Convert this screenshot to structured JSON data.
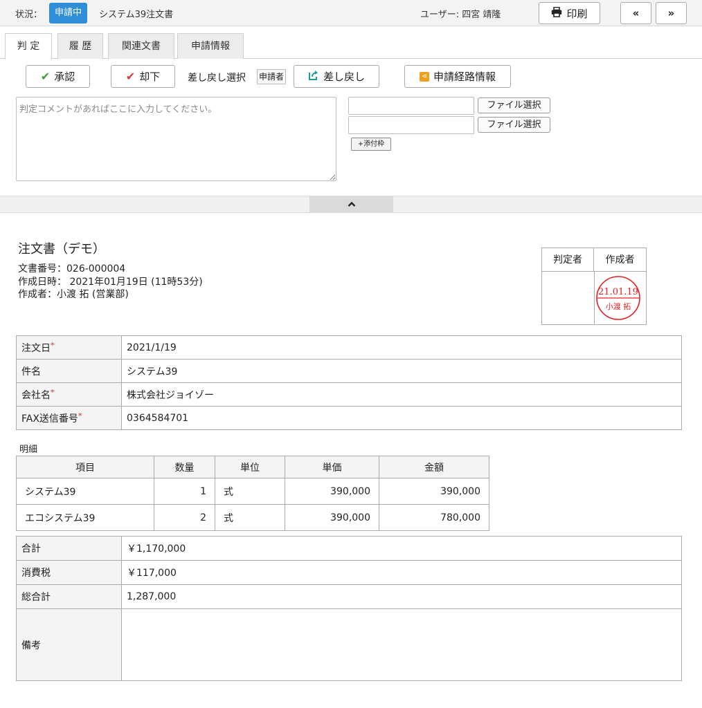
{
  "topbar": {
    "status_label": "状況：",
    "status_badge": "申請中",
    "doc_title": "システム39注文書",
    "user": "ユーザー: 四宮 靖隆",
    "print_label": "印刷",
    "prev_label": "«",
    "next_label": "»"
  },
  "tabs": [
    {
      "label": "判 定"
    },
    {
      "label": "履 歴"
    },
    {
      "label": "関連文書"
    },
    {
      "label": "申請情報"
    }
  ],
  "actions": {
    "approve": "承認",
    "reject": "却下",
    "sendback_select_label": "差し戻し選択",
    "sendback_target": "申請者",
    "sendback": "差し戻し",
    "route_info": "申請経路情報"
  },
  "comment": {
    "placeholder": "判定コメントがあればここに入力してください。"
  },
  "files": {
    "select_label": "ファイル選択",
    "add_attachment": "+添付枠"
  },
  "collapse_icon": "^",
  "document": {
    "heading": "注文書（デモ）",
    "doc_number": "文書番号：026-000004",
    "created_at": "作成日時： 2021年01月19日 (11時53分)",
    "author": "作成者：小渡 拓 (営業部)"
  },
  "stamp": {
    "judge_header": "判定者",
    "creator_header": "作成者",
    "seal_date": "21.01.19",
    "seal_name": "小渡 拓",
    "seal_color": "#e02020"
  },
  "info": [
    {
      "label": "注文日",
      "required": "*",
      "value": "2021/1/19"
    },
    {
      "label": "件名",
      "required": "",
      "value": "システム39"
    },
    {
      "label": "会社名",
      "required": "*",
      "value": "株式会社ジョイゾー"
    },
    {
      "label": "FAX送信番号",
      "required": "*",
      "value": "0364584701"
    }
  ],
  "detail": {
    "label": "明細",
    "headers": [
      "項目",
      "数量",
      "単位",
      "単価",
      "金額"
    ],
    "rows": [
      [
        "システム39",
        "1",
        "式",
        "390,000",
        "390,000"
      ],
      [
        "エコシステム39",
        "2",
        "式",
        "390,000",
        "780,000"
      ]
    ]
  },
  "summary": [
    {
      "label": "合計",
      "value": "￥1,170,000"
    },
    {
      "label": "消費税",
      "value": "￥117,000"
    },
    {
      "label": "総合計",
      "value": "1,287,000"
    },
    {
      "label": "備考",
      "value": ""
    }
  ],
  "colors": {
    "badge": "#2e8fd8",
    "approve": "#3aa03a",
    "reject": "#d43a3a",
    "route": "#f0a020"
  }
}
